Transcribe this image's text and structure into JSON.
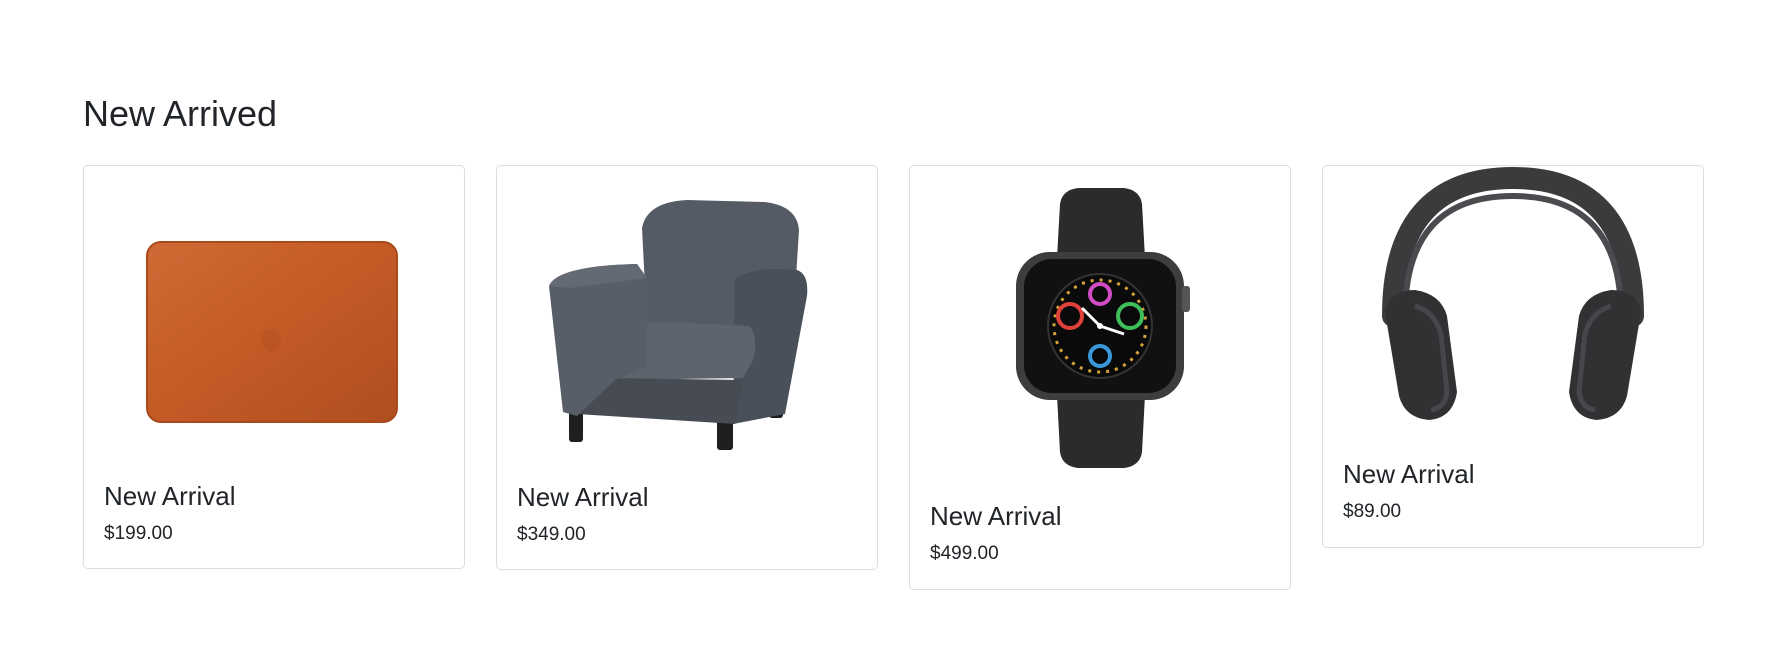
{
  "section": {
    "title": "New Arrived"
  },
  "products": [
    {
      "title": "New Arrival",
      "price": "$199.00",
      "image": "laptop-sleeve-image",
      "color": "#c65a28"
    },
    {
      "title": "New Arrival",
      "price": "$349.00",
      "image": "armchair-image",
      "color": "#4d535c"
    },
    {
      "title": "New Arrival",
      "price": "$499.00",
      "image": "smartwatch-image",
      "color": "#2f2f30"
    },
    {
      "title": "New Arrival",
      "price": "$89.00",
      "image": "headphones-image",
      "color": "#3a3b3d"
    }
  ]
}
